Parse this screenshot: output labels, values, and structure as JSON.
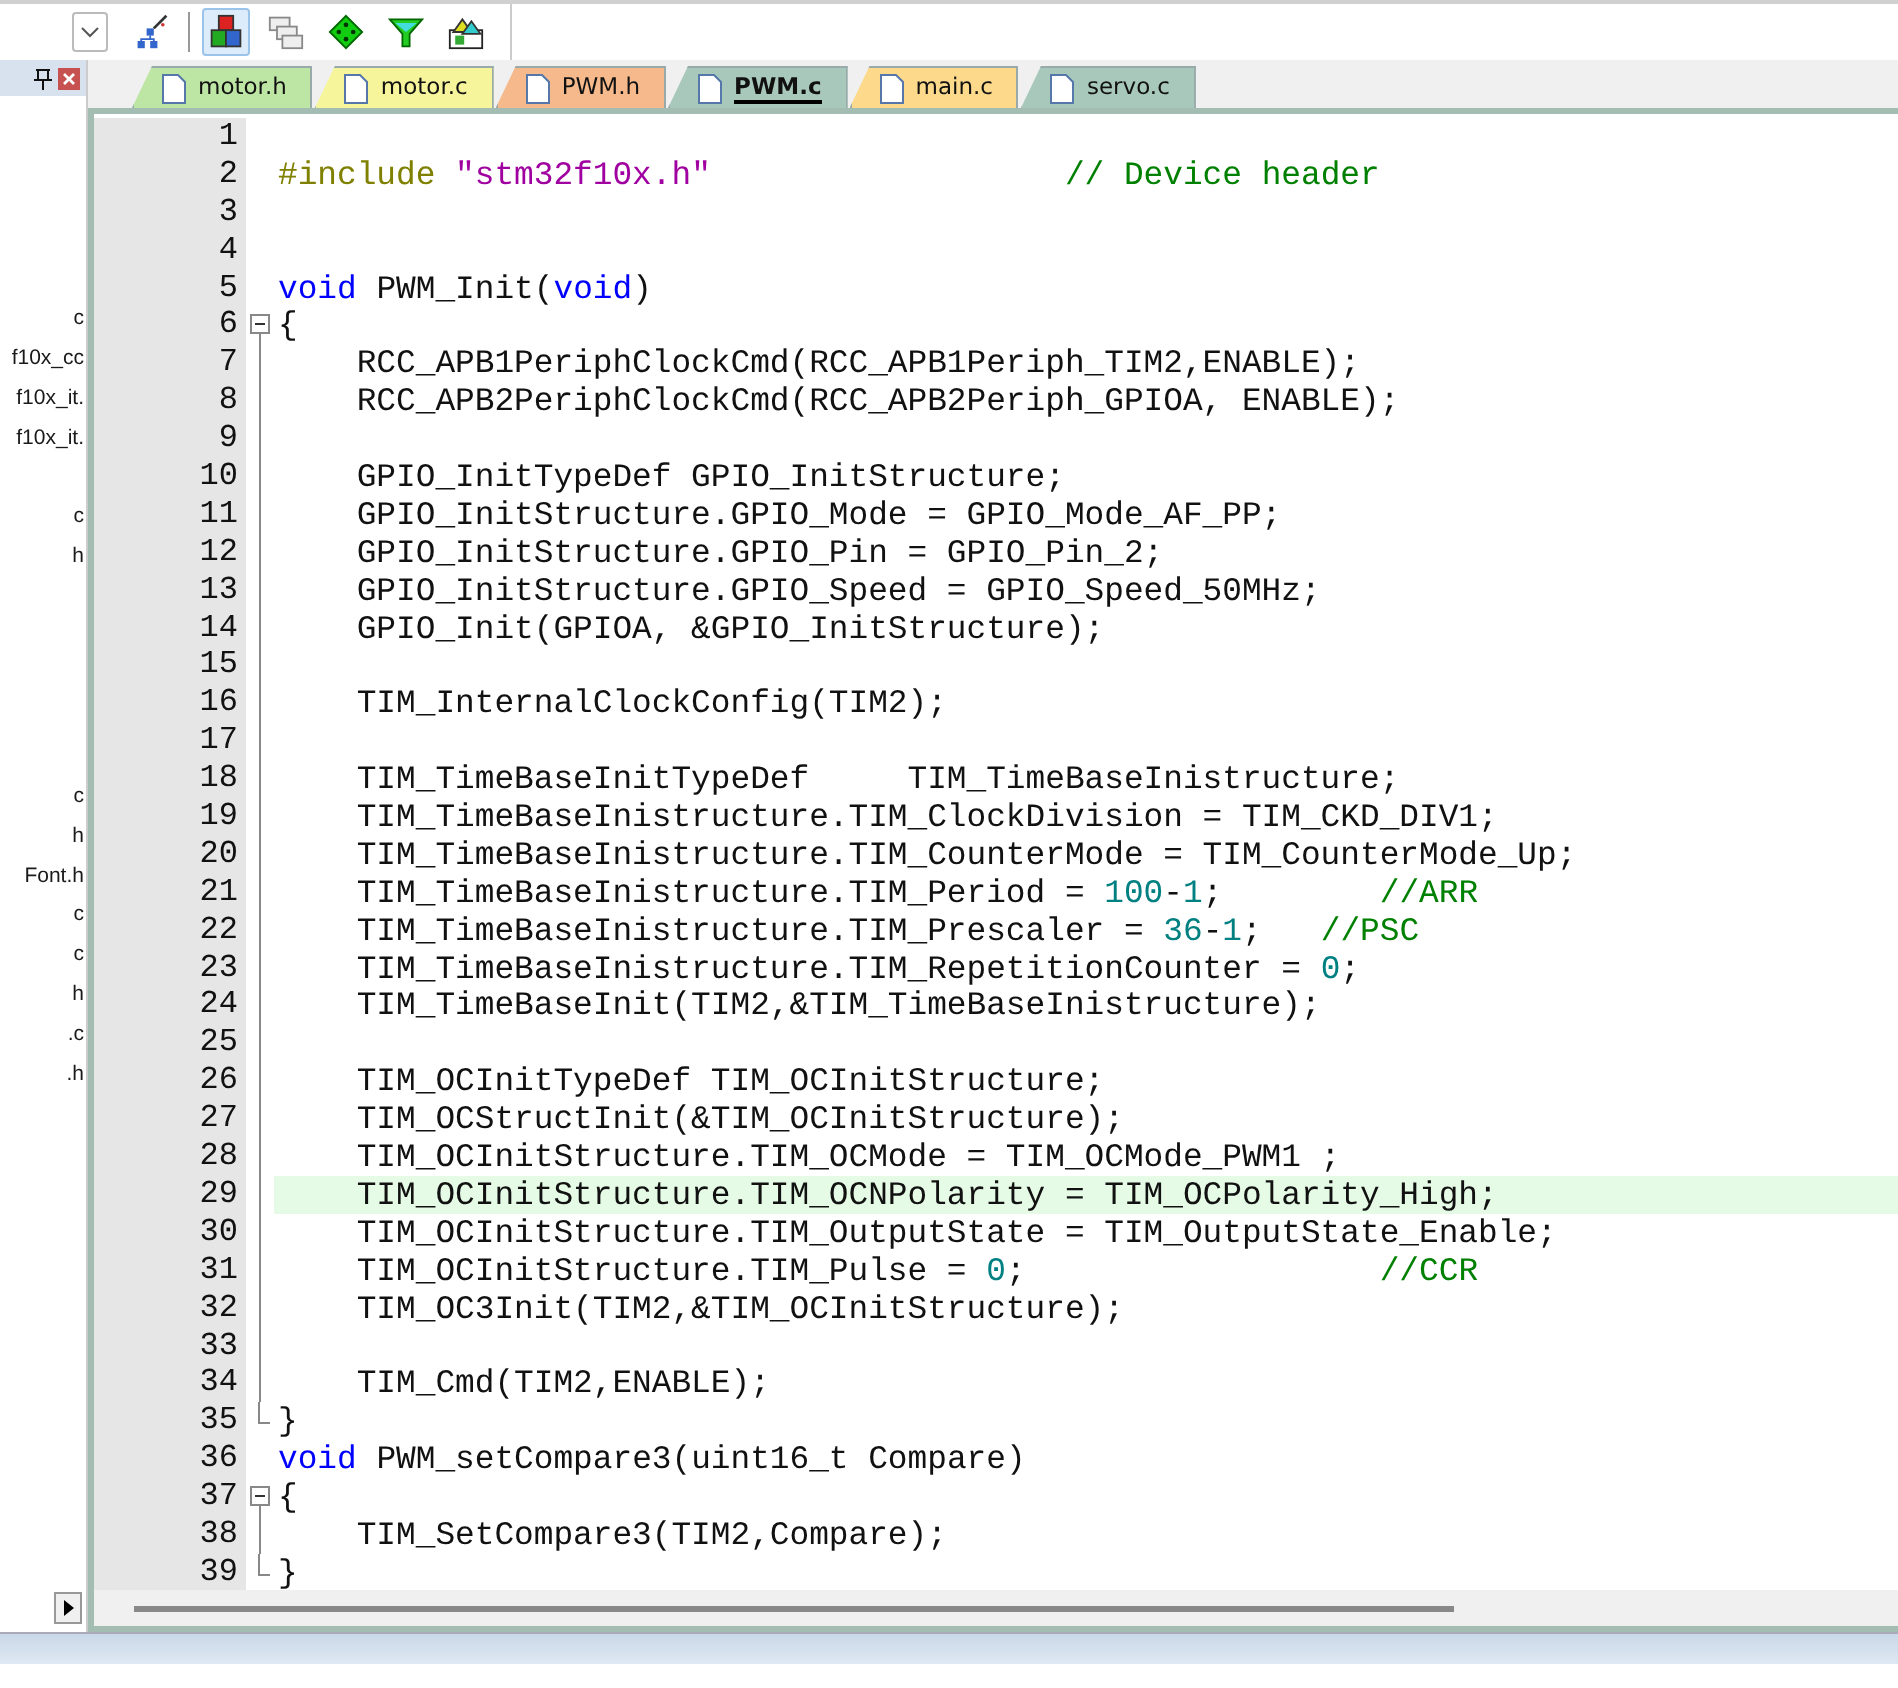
{
  "toolbar": {
    "buttons": [
      {
        "kind": "dropdown",
        "pressed": false
      },
      {
        "kind": "wand",
        "pressed": false
      },
      {
        "kind": "blocks",
        "pressed": true
      },
      {
        "kind": "windows",
        "pressed": false
      },
      {
        "kind": "diamond",
        "pressed": false
      },
      {
        "kind": "funnel",
        "pressed": false
      },
      {
        "kind": "stack",
        "pressed": false
      }
    ]
  },
  "sidebar": {
    "groups": [
      {
        "items": [
          {
            "text": "c"
          },
          {
            "text": "f10x_cc"
          },
          {
            "text": "f10x_it."
          },
          {
            "text": "f10x_it."
          }
        ]
      },
      {
        "items": [
          {
            "text": "c"
          },
          {
            "text": "h"
          }
        ]
      },
      {
        "items": [
          {
            "text": "c"
          },
          {
            "text": "h"
          },
          {
            "text": "Font.h"
          },
          {
            "text": "c"
          },
          {
            "text": "c"
          },
          {
            "text": "h"
          },
          {
            "text": ".c"
          },
          {
            "text": ".h"
          }
        ]
      }
    ]
  },
  "tabs": [
    {
      "label": "motor.h",
      "color": "#bde5a4",
      "selected": false
    },
    {
      "label": "motor.c",
      "color": "#f6f59c",
      "selected": false
    },
    {
      "label": "PWM.h",
      "color": "#f5b98c",
      "selected": false
    },
    {
      "label": "PWM.c",
      "color": "#a8c8bc",
      "selected": true
    },
    {
      "label": "main.c",
      "color": "#fdd98c",
      "selected": false
    },
    {
      "label": "servo.c",
      "color": "#a8c8bc",
      "selected": false
    }
  ],
  "editor": {
    "lines": [
      {
        "number": "1",
        "kind": "plain"
      },
      {
        "number": "2",
        "kind": "plain",
        "segments": [
          {
            "kind": "preproc",
            "text": "#include "
          },
          {
            "kind": "string",
            "text": "\"stm32f10x.h\""
          },
          {
            "kind": "comment",
            "text": "                  // Device header"
          }
        ]
      },
      {
        "number": "3",
        "kind": "plain"
      },
      {
        "number": "4",
        "kind": "plain"
      },
      {
        "number": "5",
        "kind": "plain",
        "segments": [
          {
            "kind": "keyword",
            "text": "void"
          },
          {
            "kind": "plain",
            "text": " PWM_Init("
          },
          {
            "kind": "keyword",
            "text": "void"
          },
          {
            "kind": "plain",
            "text": ")"
          }
        ]
      },
      {
        "number": "6",
        "kind": "open",
        "segments": [
          {
            "kind": "plain",
            "text": "{"
          }
        ]
      },
      {
        "number": "7",
        "kind": "body",
        "segments": [
          {
            "kind": "plain",
            "text": "    RCC_APB1PeriphClockCmd(RCC_APB1Periph_TIM2,ENABLE);"
          }
        ]
      },
      {
        "number": "8",
        "kind": "body",
        "segments": [
          {
            "kind": "plain",
            "text": "    RCC_APB2PeriphClockCmd(RCC_APB2Periph_GPIOA, ENABLE);"
          }
        ]
      },
      {
        "number": "9",
        "kind": "body"
      },
      {
        "number": "10",
        "kind": "body",
        "segments": [
          {
            "kind": "plain",
            "text": "    GPIO_InitTypeDef GPIO_InitStructure;"
          }
        ]
      },
      {
        "number": "11",
        "kind": "body",
        "segments": [
          {
            "kind": "plain",
            "text": "    GPIO_InitStructure.GPIO_Mode = GPIO_Mode_AF_PP;"
          }
        ]
      },
      {
        "number": "12",
        "kind": "body",
        "segments": [
          {
            "kind": "plain",
            "text": "    GPIO_InitStructure.GPIO_Pin = GPIO_Pin_2;"
          }
        ]
      },
      {
        "number": "13",
        "kind": "body",
        "segments": [
          {
            "kind": "plain",
            "text": "    GPIO_InitStructure.GPIO_Speed = GPIO_Speed_50MHz;"
          }
        ]
      },
      {
        "number": "14",
        "kind": "body",
        "segments": [
          {
            "kind": "plain",
            "text": "    GPIO_Init(GPIOA, &GPIO_InitStructure);"
          }
        ]
      },
      {
        "number": "15",
        "kind": "body"
      },
      {
        "number": "16",
        "kind": "body",
        "segments": [
          {
            "kind": "plain",
            "text": "    TIM_InternalClockConfig(TIM2);"
          }
        ]
      },
      {
        "number": "17",
        "kind": "body"
      },
      {
        "number": "18",
        "kind": "body",
        "segments": [
          {
            "kind": "plain",
            "text": "    TIM_TimeBaseInitTypeDef     TIM_TimeBaseInistructure;"
          }
        ]
      },
      {
        "number": "19",
        "kind": "body",
        "segments": [
          {
            "kind": "plain",
            "text": "    TIM_TimeBaseInistructure.TIM_ClockDivision = TIM_CKD_DIV1;"
          }
        ]
      },
      {
        "number": "20",
        "kind": "body",
        "segments": [
          {
            "kind": "plain",
            "text": "    TIM_TimeBaseInistructure.TIM_CounterMode = TIM_CounterMode_Up;"
          }
        ]
      },
      {
        "number": "21",
        "kind": "body",
        "segments": [
          {
            "kind": "plain",
            "text": "    TIM_TimeBaseInistructure.TIM_Period = "
          },
          {
            "kind": "number",
            "text": "100"
          },
          {
            "kind": "plain",
            "text": "-"
          },
          {
            "kind": "number",
            "text": "1"
          },
          {
            "kind": "plain",
            "text": ";        "
          },
          {
            "kind": "comment",
            "text": "//ARR"
          }
        ]
      },
      {
        "number": "22",
        "kind": "body",
        "segments": [
          {
            "kind": "plain",
            "text": "    TIM_TimeBaseInistructure.TIM_Prescaler = "
          },
          {
            "kind": "number",
            "text": "36"
          },
          {
            "kind": "plain",
            "text": "-"
          },
          {
            "kind": "number",
            "text": "1"
          },
          {
            "kind": "plain",
            "text": ";   "
          },
          {
            "kind": "comment",
            "text": "//PSC"
          }
        ]
      },
      {
        "number": "23",
        "kind": "body",
        "segments": [
          {
            "kind": "plain",
            "text": "    TIM_TimeBaseInistructure.TIM_RepetitionCounter = "
          },
          {
            "kind": "number",
            "text": "0"
          },
          {
            "kind": "plain",
            "text": ";"
          }
        ]
      },
      {
        "number": "24",
        "kind": "body",
        "segments": [
          {
            "kind": "plain",
            "text": "    TIM_TimeBaseInit(TIM2,&TIM_TimeBaseInistructure);"
          }
        ]
      },
      {
        "number": "25",
        "kind": "body"
      },
      {
        "number": "26",
        "kind": "body",
        "segments": [
          {
            "kind": "plain",
            "text": "    TIM_OCInitTypeDef TIM_OCInitStructure;"
          }
        ]
      },
      {
        "number": "27",
        "kind": "body",
        "segments": [
          {
            "kind": "plain",
            "text": "    TIM_OCStructInit(&TIM_OCInitStructure);"
          }
        ]
      },
      {
        "number": "28",
        "kind": "body",
        "segments": [
          {
            "kind": "plain",
            "text": "    TIM_OCInitStructure.TIM_OCMode = TIM_OCMode_PWM1 ;"
          }
        ]
      },
      {
        "number": "29",
        "kind": "body",
        "highlighted": true,
        "segments": [
          {
            "kind": "plain",
            "text": "    TIM_OCInitStructure.TIM_OCNPolarity = TIM_OCPolarity_High;"
          }
        ]
      },
      {
        "number": "30",
        "kind": "body",
        "segments": [
          {
            "kind": "plain",
            "text": "    TIM_OCInitStructure.TIM_OutputState = TIM_OutputState_Enable;"
          }
        ]
      },
      {
        "number": "31",
        "kind": "body",
        "segments": [
          {
            "kind": "plain",
            "text": "    TIM_OCInitStructure.TIM_Pulse = "
          },
          {
            "kind": "number",
            "text": "0"
          },
          {
            "kind": "plain",
            "text": ";                  "
          },
          {
            "kind": "comment",
            "text": "//CCR"
          }
        ]
      },
      {
        "number": "32",
        "kind": "body",
        "segments": [
          {
            "kind": "plain",
            "text": "    TIM_OC3Init(TIM2,&TIM_OCInitStructure);"
          }
        ]
      },
      {
        "number": "33",
        "kind": "body"
      },
      {
        "number": "34",
        "kind": "body",
        "segments": [
          {
            "kind": "plain",
            "text": "    TIM_Cmd(TIM2,ENABLE);"
          }
        ]
      },
      {
        "number": "35",
        "kind": "close",
        "segments": [
          {
            "kind": "plain",
            "text": "}"
          }
        ]
      },
      {
        "number": "36",
        "kind": "plain",
        "segments": [
          {
            "kind": "keyword",
            "text": "void"
          },
          {
            "kind": "plain",
            "text": " PWM_setCompare3(uint16_t Compare)"
          }
        ]
      },
      {
        "number": "37",
        "kind": "open",
        "segments": [
          {
            "kind": "plain",
            "text": "{"
          }
        ]
      },
      {
        "number": "38",
        "kind": "body",
        "segments": [
          {
            "kind": "plain",
            "text": "    TIM_SetCompare3(TIM2,Compare);"
          }
        ]
      },
      {
        "number": "39",
        "kind": "close",
        "segments": [
          {
            "kind": "plain",
            "text": "}"
          }
        ]
      }
    ]
  }
}
